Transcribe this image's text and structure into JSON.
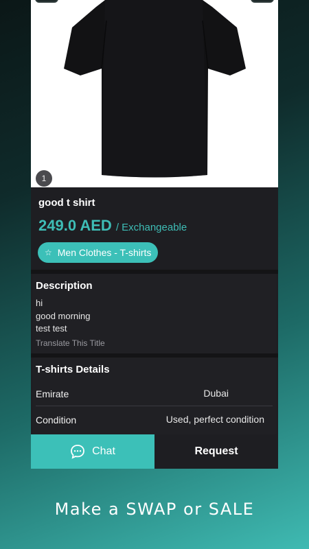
{
  "product": {
    "title": "good t shirt",
    "price": "249.0 AED",
    "price_suffix": "/ Exchangeable",
    "category_chip": "Men Clothes - T-shirts",
    "image_index": "1",
    "image_icon": "tshirt-image"
  },
  "description": {
    "heading": "Description",
    "lines": [
      "hi",
      "good morning",
      "test test"
    ],
    "translate_link": "Translate This Title"
  },
  "details": {
    "heading": "T-shirts Details",
    "rows": [
      {
        "label": "Emirate",
        "value": "Dubai"
      },
      {
        "label": "Condition",
        "value": "Used, perfect condition"
      }
    ]
  },
  "actions": {
    "chat_label": "Chat",
    "chat_icon": "chat-bubble-icon",
    "request_label": "Request"
  },
  "tagline": "Make a  SWAP or SALE",
  "colors": {
    "accent": "#3cc0b8",
    "card_background": "#1e1e22",
    "price_text": "#3ebdb6"
  }
}
